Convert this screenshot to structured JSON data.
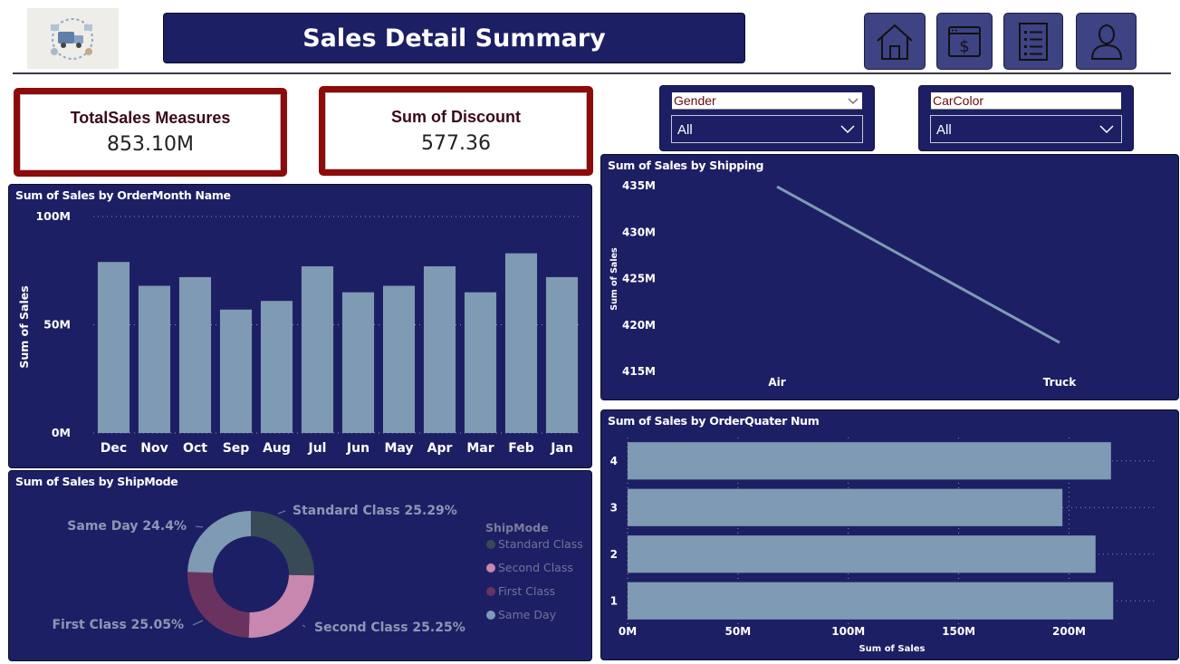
{
  "header": {
    "title": "Sales Detail Summary",
    "logo_icon": "delivery-logo-icon",
    "nav_icons": [
      "home-icon",
      "dollar-page-icon",
      "document-list-icon",
      "user-icon"
    ]
  },
  "kpis": {
    "total_sales": {
      "label": "TotalSales Measures",
      "value": "853.10M"
    },
    "discount": {
      "label": "Sum of Discount",
      "value": "577.36"
    }
  },
  "slicers": {
    "gender": {
      "header": "Gender",
      "value": "All"
    },
    "carcolor": {
      "header": "CarColor",
      "value": "All"
    }
  },
  "colors": {
    "panel_bg": "#1d1f64",
    "bar": "#7f9ab3",
    "kpi_border": "#8c0b0b",
    "standard_class": "#374a55",
    "second_class": "#c787ae",
    "first_class": "#6a335f",
    "same_day": "#7f9ab3"
  },
  "charts": {
    "month": {
      "title": "Sum of Sales by OrderMonth Name",
      "ylabel": "Sum of Sales",
      "y_ticks": [
        "100M",
        "50M",
        "0M"
      ]
    },
    "shipping": {
      "title": "Sum of Sales by Shipping",
      "ylabel": "Sum of Sales",
      "y_ticks": [
        "435M",
        "430M",
        "425M",
        "420M",
        "415M"
      ]
    },
    "shipmode": {
      "title": "Sum of Sales by ShipMode",
      "legend_title": "ShipMode"
    },
    "quarter": {
      "title": "Sum of Sales by OrderQuater Num",
      "xlabel": "Sum of Sales",
      "x_ticks": [
        "0M",
        "50M",
        "100M",
        "150M",
        "200M"
      ]
    }
  },
  "chart_data": [
    {
      "type": "bar",
      "title": "Sum of Sales by OrderMonth Name",
      "xlabel": "",
      "ylabel": "Sum of Sales",
      "ylim": [
        0,
        100
      ],
      "unit": "M",
      "categories": [
        "Dec",
        "Nov",
        "Oct",
        "Sep",
        "Aug",
        "Jul",
        "Jun",
        "May",
        "Apr",
        "Mar",
        "Feb",
        "Jan"
      ],
      "values": [
        79,
        68,
        72,
        57,
        61,
        77,
        65,
        68,
        77,
        65,
        83,
        72
      ],
      "grid": true
    },
    {
      "type": "line",
      "title": "Sum of Sales by Shipping",
      "xlabel": "",
      "ylabel": "Sum of Sales",
      "ylim": [
        415,
        435
      ],
      "unit": "M",
      "categories": [
        "Air",
        "Truck"
      ],
      "values": [
        434.9,
        418.1
      ],
      "grid": false
    },
    {
      "type": "pie",
      "title": "Sum of Sales by ShipMode",
      "legend_title": "ShipMode",
      "legend_position": "right",
      "labels": [
        "Standard Class",
        "Second Class",
        "First Class",
        "Same Day"
      ],
      "values": [
        25.29,
        25.25,
        25.05,
        24.4
      ],
      "slice_labels": [
        "Standard Class 25.29%",
        "Second Class 25.25%",
        "First Class 25.05%",
        "Same Day 24.4%"
      ]
    },
    {
      "type": "bar",
      "orientation": "horizontal",
      "title": "Sum of Sales by OrderQuater Num",
      "xlabel": "Sum of Sales",
      "ylabel": "",
      "xlim": [
        0,
        240
      ],
      "unit": "M",
      "categories": [
        "4",
        "3",
        "2",
        "1"
      ],
      "values": [
        219,
        197,
        212,
        220
      ],
      "grid": true
    }
  ]
}
